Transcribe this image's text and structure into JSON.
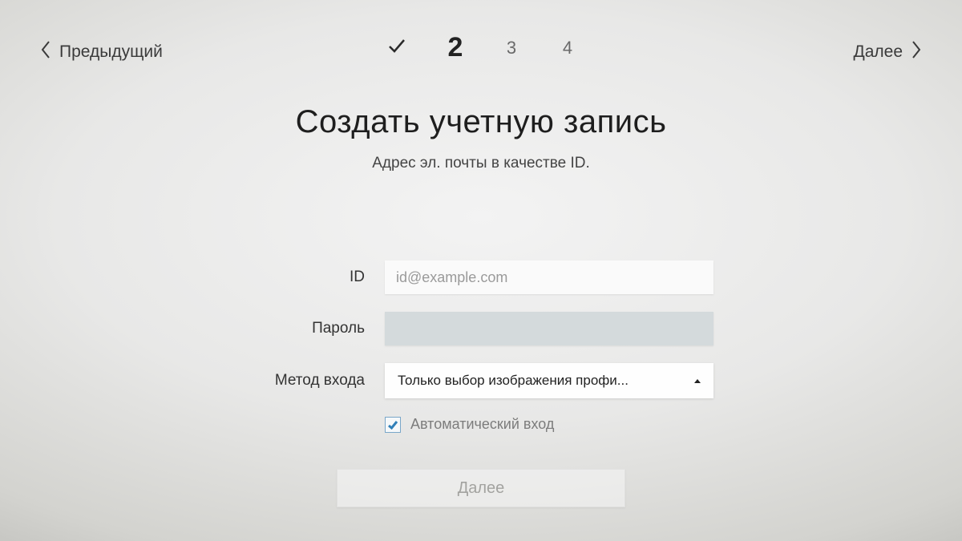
{
  "nav": {
    "prev": "Предыдущий",
    "next": "Далее"
  },
  "steps": {
    "completed_icon": "check",
    "current": "2",
    "s3": "3",
    "s4": "4"
  },
  "heading": {
    "title": "Создать учетную запись",
    "subtitle": "Адрес эл. почты в качестве ID."
  },
  "form": {
    "id_label": "ID",
    "id_placeholder": "id@example.com",
    "password_label": "Пароль",
    "password_value": "",
    "method_label": "Метод входа",
    "method_selected": "Только выбор изображения профи...",
    "auto_login_label": "Автоматический вход",
    "auto_login_checked": true
  },
  "bottom": {
    "next_label": "Далее"
  }
}
